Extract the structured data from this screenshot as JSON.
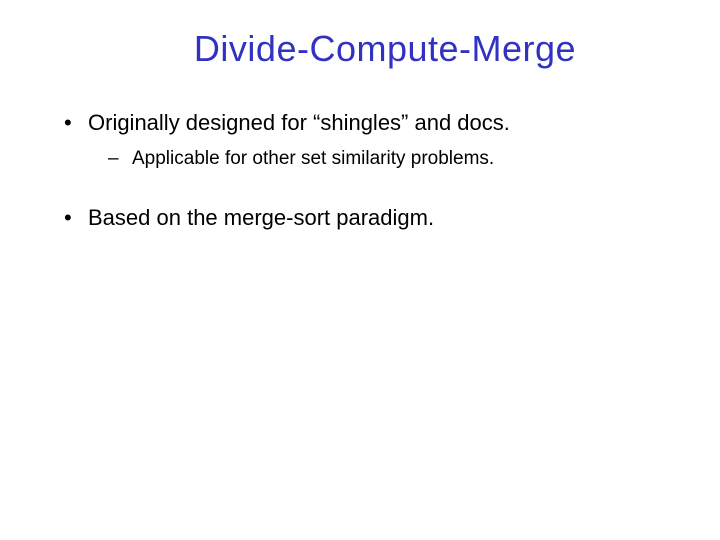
{
  "slide": {
    "title": "Divide-Compute-Merge",
    "bullets": [
      {
        "text": "Originally designed for “shingles” and docs.",
        "children": [
          {
            "text": "Applicable for other set similarity problems."
          }
        ]
      },
      {
        "text": "Based on the merge-sort paradigm.",
        "children": []
      }
    ]
  }
}
